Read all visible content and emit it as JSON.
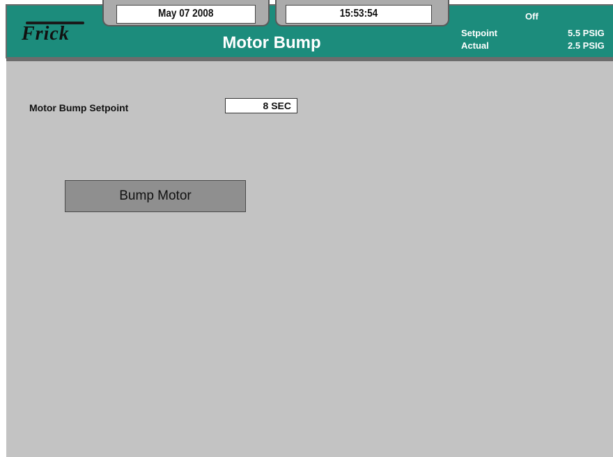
{
  "header": {
    "logo_text": "Frick",
    "date": "May 07 2008",
    "time": "15:53:54",
    "title": "Motor Bump",
    "status": "Off",
    "setpoint_label": "Setpoint",
    "setpoint_value": "5.5 PSIG",
    "actual_label": "Actual",
    "actual_value": "2.5 PSIG"
  },
  "main": {
    "setpoint_label": "Motor Bump Setpoint",
    "setpoint_value": "8 SEC",
    "bump_button_label": "Bump Motor"
  },
  "colors": {
    "header_accent": "#1c8c7c",
    "background": "#c3c3c3",
    "button": "#8f8f8f"
  }
}
